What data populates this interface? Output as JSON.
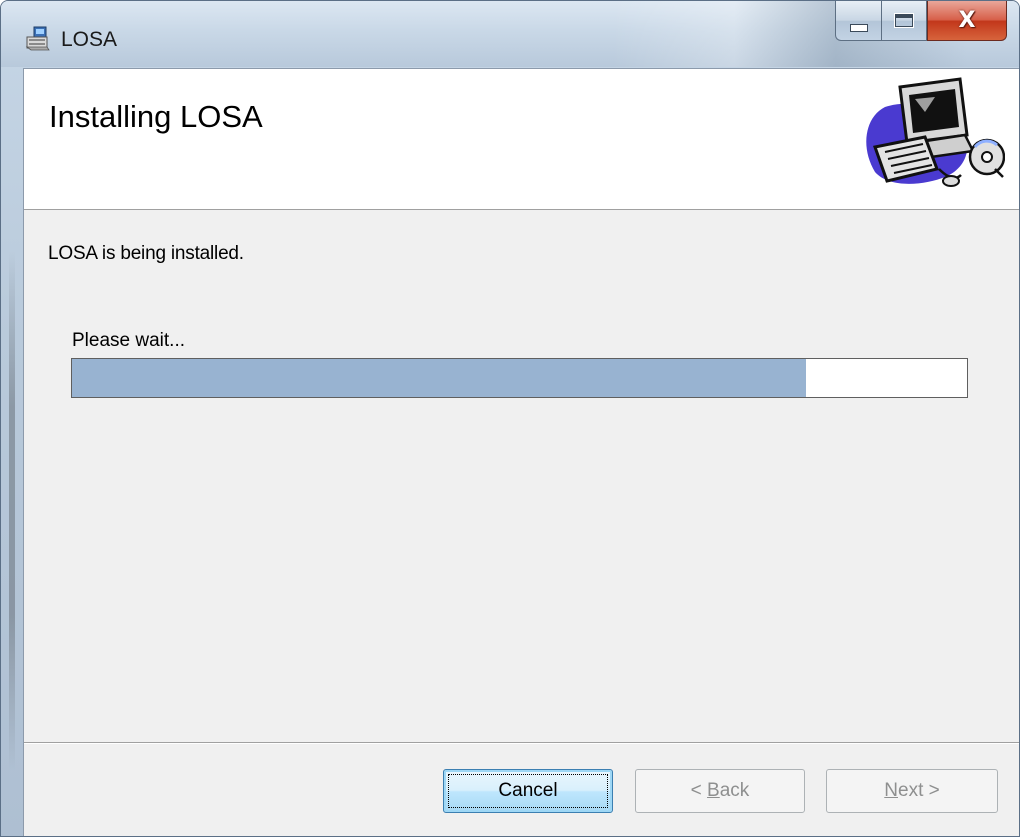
{
  "window": {
    "title": "LOSA",
    "close_glyph": "X"
  },
  "banner": {
    "title": "Installing LOSA",
    "art_icon": "computer-cd-icon"
  },
  "body": {
    "status": "LOSA is being installed.",
    "wait_label": "Please wait...",
    "progress_fraction": 0.82
  },
  "buttons": {
    "cancel": "Cancel",
    "back_prefix": "< ",
    "back_accel": "B",
    "back_rest": "ack",
    "next_accel": "N",
    "next_rest": "ext >"
  },
  "colors": {
    "progress_fill": "#98b3d1",
    "close_button": "#c2371b"
  }
}
